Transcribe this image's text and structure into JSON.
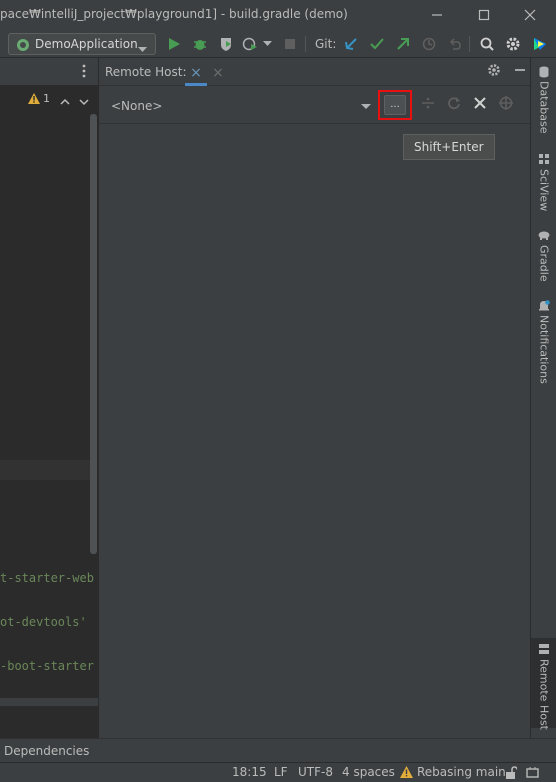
{
  "window": {
    "title": "pace₩intelliJ_project₩playground1] - build.gradle (demo)"
  },
  "toolbar": {
    "run_config": "DemoApplication",
    "git_label": "Git:"
  },
  "editor": {
    "warning_count": "1",
    "code_lines": [
      "t-starter-web",
      "ot-devtools'",
      "-boot-starter"
    ]
  },
  "remote_host": {
    "title": "Remote Host:",
    "selected_host": "<None>",
    "browse_label": "...",
    "tooltip": "Shift+Enter"
  },
  "right_tabs": [
    "Database",
    "SciView",
    "Gradle",
    "Notifications",
    "Remote Host"
  ],
  "bottom": {
    "dependencies_label": "Dependencies"
  },
  "status": {
    "position": "18:15",
    "line_ending": "LF",
    "encoding": "UTF-8",
    "indent": "4 spaces",
    "git_branch": "Rebasing main"
  },
  "colors": {
    "accent": "#4a88c7",
    "highlight": "#e81010",
    "run_green": "#499c54",
    "warning": "#e0ac3a"
  }
}
